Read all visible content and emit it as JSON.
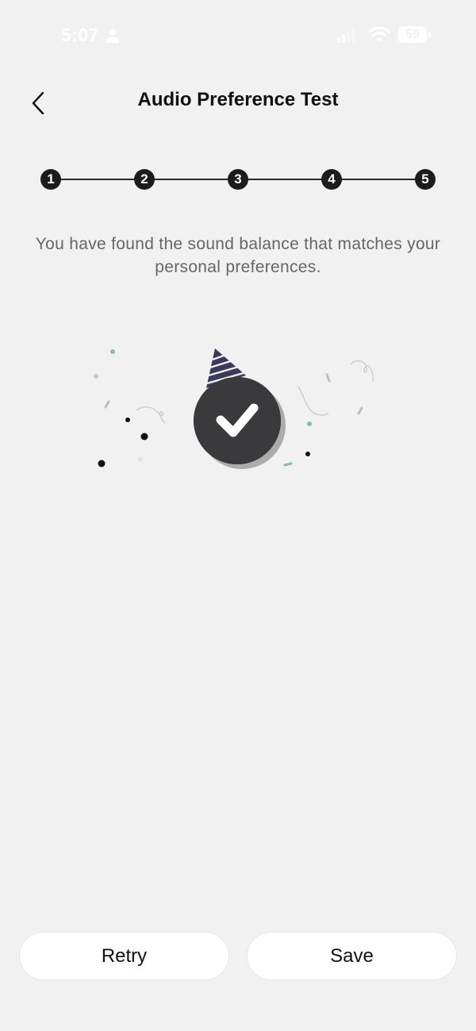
{
  "status_bar": {
    "time": "5:07",
    "battery_level": "59",
    "icons": [
      "person-icon",
      "signal-icon",
      "wifi-icon",
      "battery-icon"
    ]
  },
  "header": {
    "back_icon": "chevron-left-icon",
    "title": "Audio Preference Test"
  },
  "stepper": {
    "steps": [
      "1",
      "2",
      "3",
      "4",
      "5"
    ],
    "current_step": 5
  },
  "message": "You have found the sound balance that matches your personal preferences.",
  "illustration": {
    "icon": "party-checkmark-icon",
    "accent_color": "#7cc2a6",
    "badge_color": "#3a3a3c",
    "hat_color": "#3b3a5a"
  },
  "actions": {
    "retry_label": "Retry",
    "save_label": "Save"
  },
  "colors": {
    "background": "#f1f1f1",
    "text_primary": "#111111",
    "text_secondary": "#666666"
  }
}
